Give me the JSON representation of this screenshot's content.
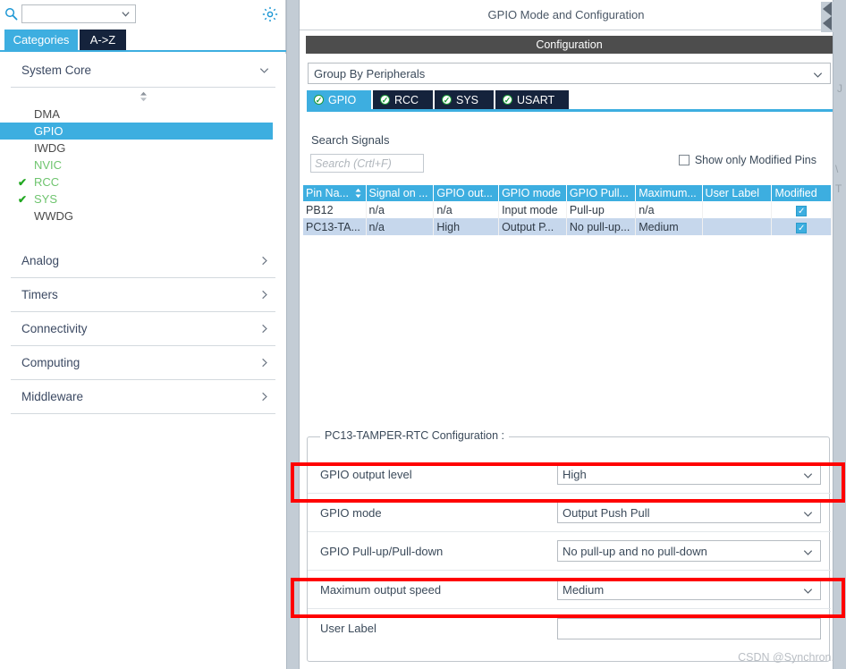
{
  "left_panel": {
    "search": {
      "value": "",
      "placeholder": ""
    },
    "gear_icon": "gear-icon",
    "magnifier_icon": "search-icon",
    "tabs": [
      {
        "label": "Categories",
        "active": true
      },
      {
        "label": "A->Z",
        "active": false
      }
    ],
    "groups": [
      {
        "label": "System Core",
        "expanded": true,
        "items": [
          {
            "label": "DMA",
            "state": "normal",
            "checked": false
          },
          {
            "label": "GPIO",
            "state": "selected",
            "checked": false
          },
          {
            "label": "IWDG",
            "state": "normal",
            "checked": false
          },
          {
            "label": "NVIC",
            "state": "green",
            "checked": false
          },
          {
            "label": "RCC",
            "state": "green",
            "checked": true
          },
          {
            "label": "SYS",
            "state": "green",
            "checked": true
          },
          {
            "label": "WWDG",
            "state": "normal",
            "checked": false
          }
        ]
      },
      {
        "label": "Analog",
        "expanded": false,
        "items": []
      },
      {
        "label": "Timers",
        "expanded": false,
        "items": []
      },
      {
        "label": "Connectivity",
        "expanded": false,
        "items": []
      },
      {
        "label": "Computing",
        "expanded": false,
        "items": []
      },
      {
        "label": "Middleware",
        "expanded": false,
        "items": []
      }
    ]
  },
  "right_panel": {
    "title": "GPIO Mode and Configuration",
    "config_bar": "Configuration",
    "group_by": {
      "value": "Group By Peripherals"
    },
    "peripheral_tabs": [
      {
        "label": "GPIO",
        "active": true
      },
      {
        "label": "RCC",
        "active": false
      },
      {
        "label": "SYS",
        "active": false
      },
      {
        "label": "USART",
        "active": false
      }
    ],
    "search_signals_label": "Search Signals",
    "signal_search": {
      "value": "",
      "placeholder": "Search (Crtl+F)"
    },
    "show_modified": {
      "label": "Show only Modified Pins",
      "checked": false
    },
    "table": {
      "columns": [
        "Pin Na...",
        "Signal on ...",
        "GPIO out...",
        "GPIO mode",
        "GPIO Pull...",
        "Maximum...",
        "User Label",
        "Modified"
      ],
      "sorted_column_index": 0,
      "rows": [
        {
          "selected": false,
          "cells": [
            "PB12",
            "n/a",
            "n/a",
            "Input mode",
            "Pull-up",
            "n/a",
            ""
          ],
          "modified": true
        },
        {
          "selected": true,
          "cells": [
            "PC13-TA...",
            "n/a",
            "High",
            "Output P...",
            "No pull-up...",
            "Medium",
            ""
          ],
          "modified": true
        }
      ]
    },
    "pin_config": {
      "legend": "PC13-TAMPER-RTC Configuration :",
      "rows": [
        {
          "label": "GPIO output level",
          "value": "High",
          "type": "select",
          "highlighted": true
        },
        {
          "label": "GPIO mode",
          "value": "Output Push Pull",
          "type": "select",
          "highlighted": false
        },
        {
          "label": "GPIO Pull-up/Pull-down",
          "value": "No pull-up and no pull-down",
          "type": "select",
          "highlighted": false
        },
        {
          "label": "Maximum output speed",
          "value": "Medium",
          "type": "select",
          "highlighted": true
        },
        {
          "label": "User Label",
          "value": "",
          "type": "text",
          "highlighted": false
        }
      ]
    }
  },
  "watermark": "CSDN @Synchron.",
  "colors": {
    "accent_blue": "#3daee0",
    "tab_dark": "#15233c",
    "header_gray": "#4d4d4d",
    "selected_row": "#c6d7ec",
    "highlight_red": "#ff0000",
    "green_check": "#22a822",
    "splitter": "#c3ccd5"
  }
}
